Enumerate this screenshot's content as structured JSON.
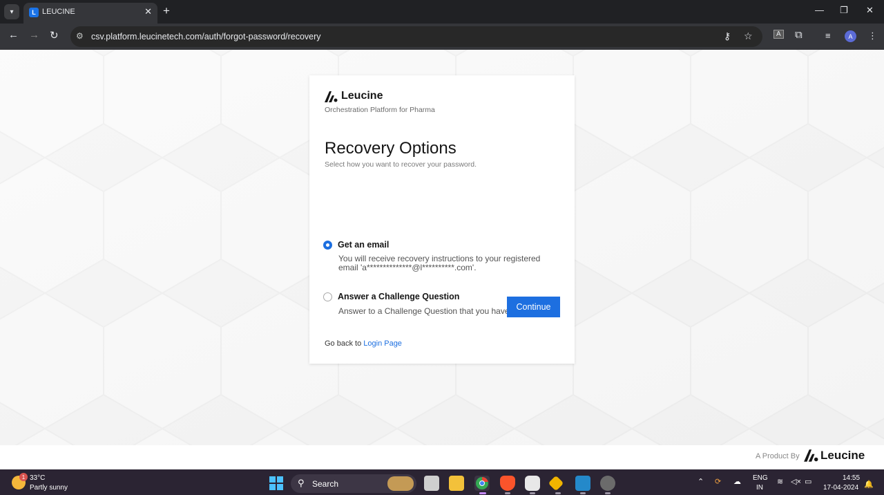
{
  "browser": {
    "tab_title": "LEUCINE",
    "tab_favicon": "L",
    "url": "csv.platform.leucinetech.com/auth/forgot-password/recovery",
    "profile_initial": "A",
    "icons": [
      "tab-search-icon",
      "close-icon",
      "plus-icon",
      "minimize-icon",
      "restore-icon",
      "close-window-icon",
      "back-icon",
      "forward-icon",
      "reload-icon",
      "site-info-icon",
      "password-key-icon",
      "star-icon",
      "translate-icon",
      "extensions-icon",
      "media-icon",
      "more-icon"
    ]
  },
  "card": {
    "brand": "Leucine",
    "tagline": "Orchestration Platform for Pharma",
    "title": "Recovery Options",
    "subtitle": "Select how you want to recover your password.",
    "options": [
      {
        "label": "Get an email",
        "description": "You will receive recovery instructions to your registered email 'a**************@l**********.com'.",
        "selected": true
      },
      {
        "label": "Answer a Challenge Question",
        "description": "Answer to a Challenge Question that you have set.",
        "selected": false
      }
    ],
    "continue_label": "Continue",
    "go_back_text": "Go back to",
    "login_link": "Login Page"
  },
  "footer": {
    "product_by": "A Product By",
    "brand": "Leucine"
  },
  "taskbar": {
    "weather_badge": "1",
    "temperature": "33°C",
    "condition": "Partly sunny",
    "search_placeholder": "Search",
    "lang_line1": "ENG",
    "lang_line2": "IN",
    "time": "14:55",
    "date": "17-04-2024"
  },
  "colors": {
    "accent": "#1d6fe0",
    "chrome_dark": "#202124",
    "taskbar": "#2b2433"
  }
}
